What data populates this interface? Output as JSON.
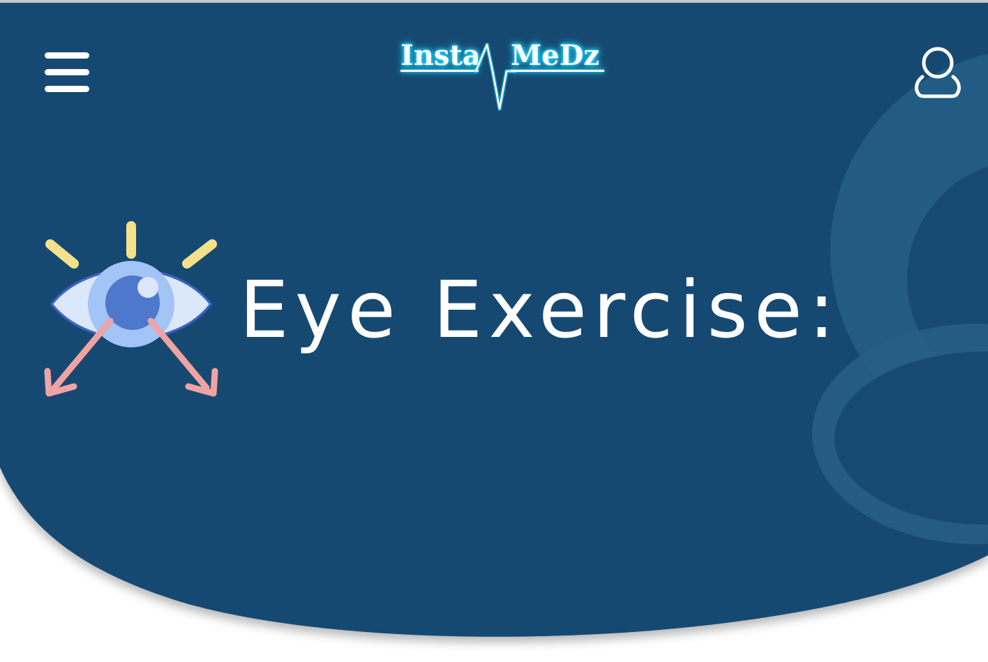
{
  "header": {
    "logo": {
      "left_word": "Insta",
      "right_word": "MeDz",
      "glow_color": "#25d8ff"
    },
    "menu_icon": "hamburger-menu-icon",
    "profile_icon": "user-profile-icon"
  },
  "hero": {
    "title": "Eye Exercise:",
    "illustration": "eye-exercise-icon",
    "background_color": "#174a72",
    "accent_ring_color": "#2b6890"
  },
  "colors": {
    "ray_yellow": "#f6e18a",
    "arrow_pink": "#f0a3a3",
    "eye_white": "#dbe7fb",
    "iris_light": "#a2c4f7",
    "iris_dark": "#4d78cc",
    "eye_outline": "#3d62c2"
  }
}
